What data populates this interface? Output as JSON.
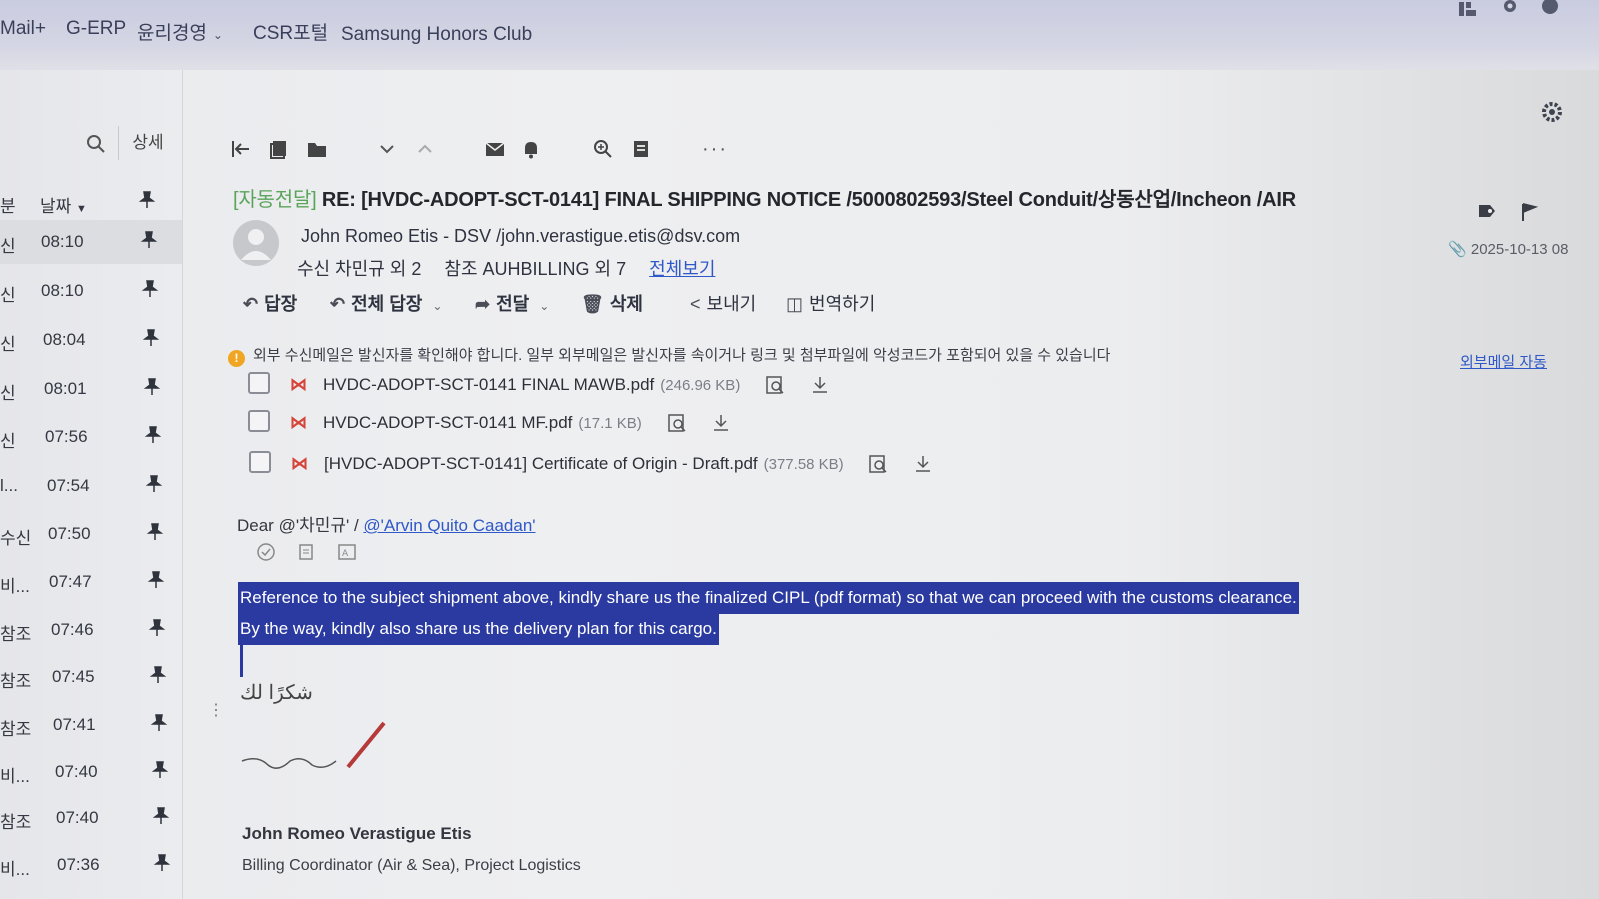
{
  "topnav": {
    "items": [
      "Mail+",
      "G-ERP",
      "윤리경영",
      "CSR포털",
      "Samsung Honors Club"
    ]
  },
  "left_panel": {
    "detail_button": "상세",
    "sort_label": "날짜",
    "column_label": "분",
    "rows": [
      {
        "label": "신",
        "time": "08:10"
      },
      {
        "label": "신",
        "time": "08:10"
      },
      {
        "label": "신",
        "time": "08:04"
      },
      {
        "label": "신",
        "time": "08:01"
      },
      {
        "label": "신",
        "time": "07:56"
      },
      {
        "label": "l...",
        "time": "07:54"
      },
      {
        "label": "수신",
        "time": "07:50"
      },
      {
        "label": "비...",
        "time": "07:47"
      },
      {
        "label": "참조",
        "time": "07:46"
      },
      {
        "label": "참조",
        "time": "07:45"
      },
      {
        "label": "참조",
        "time": "07:41"
      },
      {
        "label": "비...",
        "time": "07:40"
      },
      {
        "label": "참조",
        "time": "07:40"
      },
      {
        "label": "비...",
        "time": "07:36"
      }
    ]
  },
  "message": {
    "subject_tag": "[자동전달]",
    "subject": "RE: [HVDC-ADOPT-SCT-0141] FINAL SHIPPING NOTICE /5000802593/Steel Conduit/상동산업/Incheon /AIR",
    "sender": "John Romeo Etis - DSV  /john.verastigue.etis@dsv.com",
    "recipients_to": "수신  차민규 외 2",
    "recipients_cc": "참조  AUHBILLING 외 7",
    "view_all": "전체보기",
    "date": "2025-10-13 08",
    "actions": {
      "reply": "답장",
      "reply_all": "전체 답장",
      "forward": "전달",
      "delete": "삭제",
      "send": "보내기",
      "translate": "번역하기"
    },
    "warning": "외부 수신메일은 발신자를 확인해야 합니다. 일부 외부메일은 발신자를 속이거나 링크 및 첨부파일에 악성코드가 포함되어 있을 수 있습니다",
    "warning_link": "외부메일 자동 ",
    "attachments": [
      {
        "name": "HVDC-ADOPT-SCT-0141 FINAL MAWB.pdf",
        "size": "(246.96 KB)"
      },
      {
        "name": "HVDC-ADOPT-SCT-0141 MF.pdf",
        "size": "(17.1 KB)"
      },
      {
        "name": "[HVDC-ADOPT-SCT-0141] Certificate of Origin - Draft.pdf",
        "size": "(377.58 KB)"
      }
    ],
    "greeting_prefix": "Dear @'차민규' / ",
    "greeting_mention": "@'Arvin Quito Caadan'",
    "body_line1": "Reference to the subject shipment above, kindly share us the finalized CIPL (pdf format) so that we can proceed with the customs clearance.",
    "body_line2": "By the way, kindly also share us the delivery plan for this cargo.",
    "arabic": "شكرًا لك",
    "signature_name": "John Romeo Verastigue Etis",
    "signature_role": "Billing Coordinator (Air & Sea), Project Logistics"
  },
  "colors": {
    "accent_blue": "#2f58c8",
    "highlight": "#2a3aa0",
    "tag_green": "#5aa55a",
    "pdf_red": "#d6453a",
    "warning_orange": "#f0a623"
  }
}
